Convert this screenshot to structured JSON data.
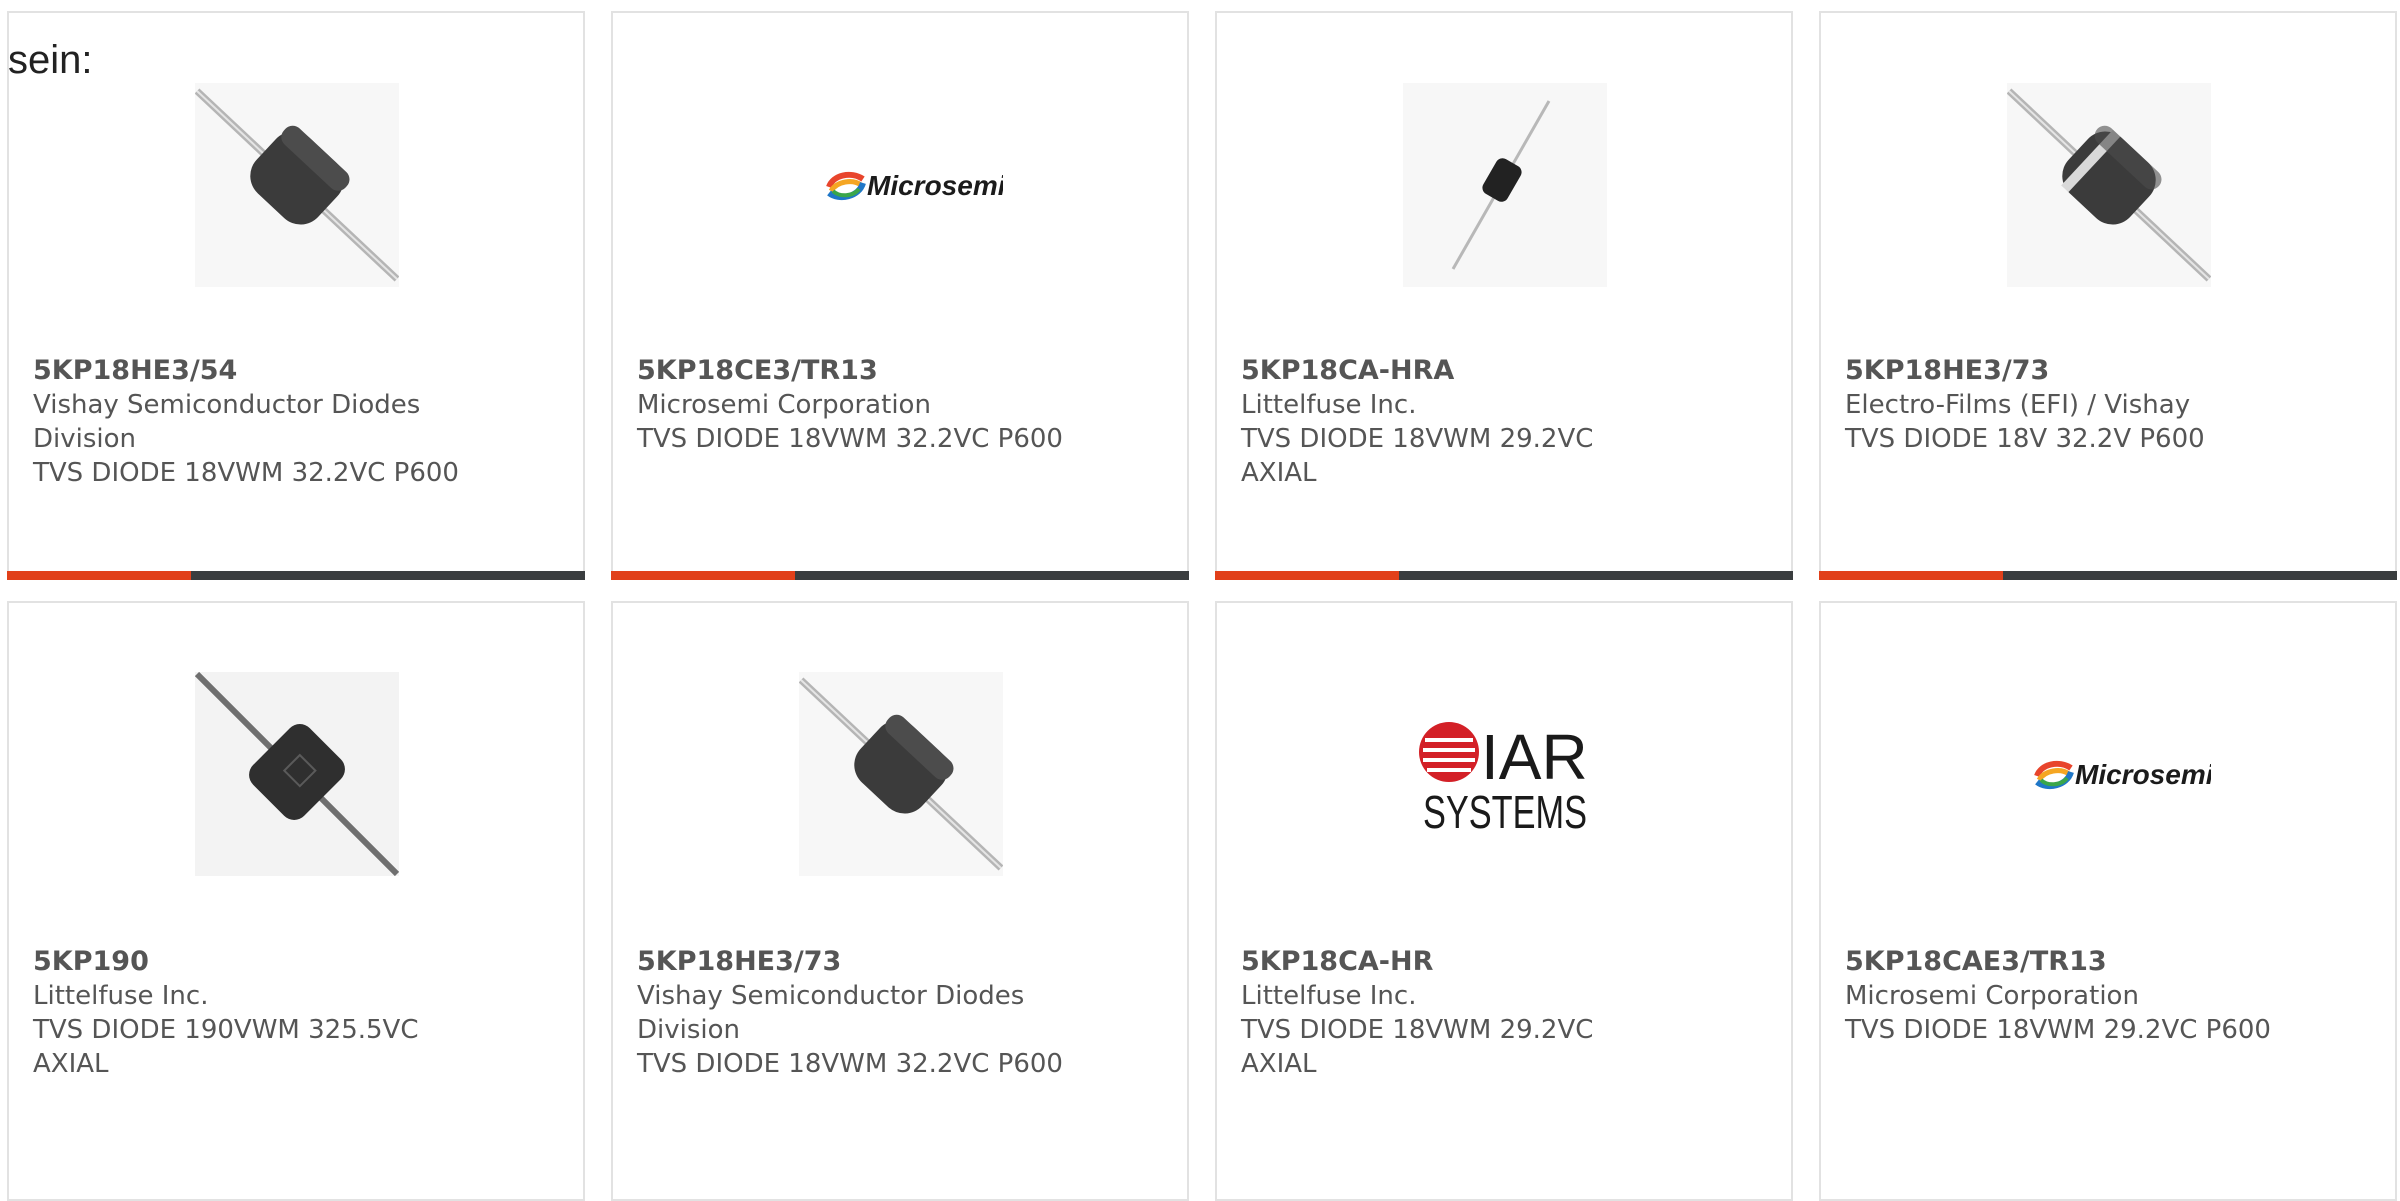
{
  "intro_text": "sein:",
  "colors": {
    "accent": "#e1401a",
    "bar": "#3a3d3f",
    "border": "#e2e2e2",
    "text": "#555555"
  },
  "products": [
    {
      "part": "5KP18HE3/54",
      "lines": [
        "Vishay Semiconductor Diodes",
        "Division",
        "TVS DIODE 18VWM 32.2VC P600"
      ],
      "image": "diode-axial-large"
    },
    {
      "part": "5KP18CE3/TR13",
      "lines": [
        "Microsemi Corporation",
        "TVS DIODE 18VWM 32.2VC P600"
      ],
      "image": "microsemi-logo",
      "logo_text": "Microsemi"
    },
    {
      "part": "5KP18CA-HRA",
      "lines": [
        "Littelfuse Inc.",
        "TVS DIODE 18VWM 29.2VC AXIAL"
      ],
      "image": "diode-axial-small"
    },
    {
      "part": "5KP18HE3/73",
      "lines": [
        "Electro-Films (EFI) / Vishay",
        "TVS DIODE 18V 32.2V P600"
      ],
      "image": "diode-axial-banded"
    },
    {
      "part": "5KP190",
      "lines": [
        "Littelfuse Inc.",
        "TVS DIODE 190VWM 325.5VC",
        "AXIAL"
      ],
      "image": "diode-axial-marked"
    },
    {
      "part": "5KP18HE3/73",
      "lines": [
        "Vishay Semiconductor Diodes",
        "Division",
        "TVS DIODE 18VWM 32.2VC P600"
      ],
      "image": "diode-axial-large"
    },
    {
      "part": "5KP18CA-HR",
      "lines": [
        "Littelfuse Inc.",
        "TVS DIODE 18VWM 29.2VC AXIAL"
      ],
      "image": "iar-systems-logo",
      "logo_text": "IAR",
      "logo_subtext": "SYSTEMS"
    },
    {
      "part": "5KP18CAE3/TR13",
      "lines": [
        "Microsemi Corporation",
        "TVS DIODE 18VWM 29.2VC P600"
      ],
      "image": "microsemi-logo",
      "logo_text": "Microsemi"
    }
  ]
}
